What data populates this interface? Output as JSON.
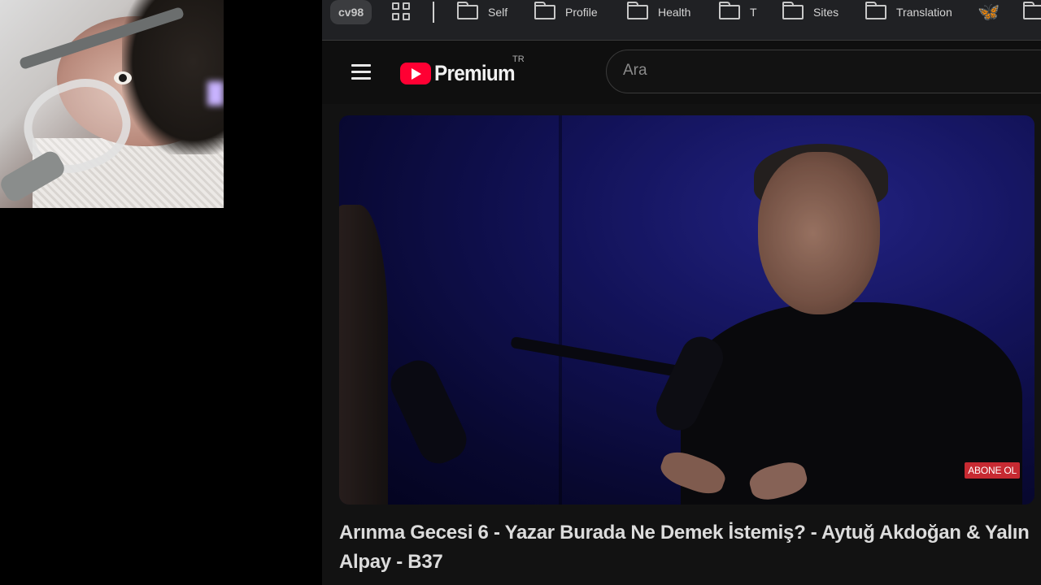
{
  "bookmarks_bar": {
    "profile_label": "cv98",
    "apps_icon": "apps-grid-icon",
    "folders": [
      {
        "label": "Self",
        "icon": "folder-icon"
      },
      {
        "label": "Profile",
        "icon": "folder-icon"
      },
      {
        "label": "Health",
        "icon": "folder-icon"
      },
      {
        "label": "T",
        "icon": "folder-icon"
      },
      {
        "label": "Sites",
        "icon": "folder-icon"
      },
      {
        "label": "Translation",
        "icon": "folder-icon"
      }
    ],
    "bluesky_icon": "butterfly-icon"
  },
  "youtube": {
    "logo_text": "Premium",
    "region": "TR",
    "brand_color": "#ff0033",
    "search_placeholder": "Ara"
  },
  "video": {
    "watermark": "ABONE OL",
    "title": "Arınma Gecesi 6 - Yazar Burada Ne Demek İstemiş? - Aytuğ Akdoğan & Yalın Alpay - B37"
  }
}
